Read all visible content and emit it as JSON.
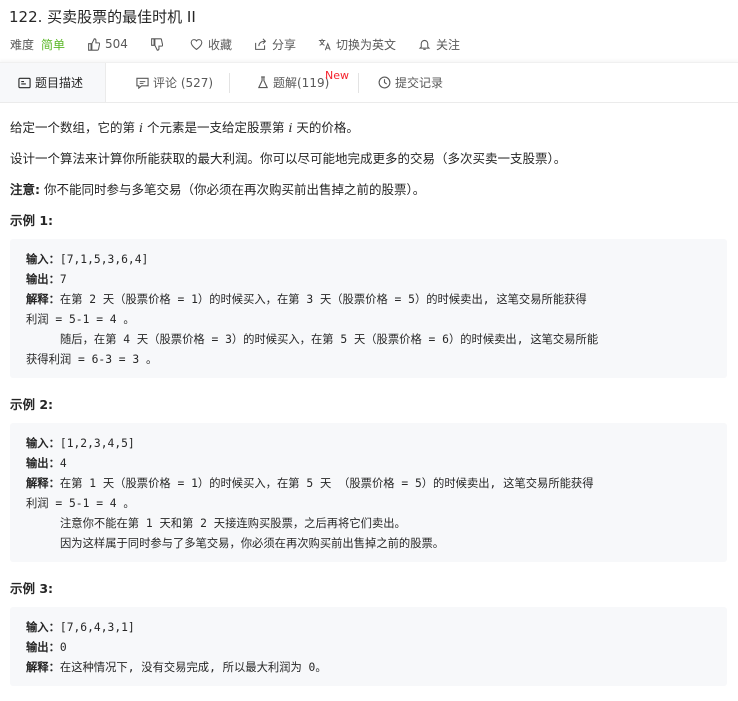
{
  "problem": {
    "title": "122. 买卖股票的最佳时机 II"
  },
  "meta": {
    "difficulty_label": "难度",
    "difficulty": "简单",
    "likes": "504",
    "favorite": "收藏",
    "share": "分享",
    "switch_lang": "切换为英文",
    "follow": "关注",
    "colors": {
      "easy": "#5ab726",
      "new_badge": "#f5222d"
    }
  },
  "tabs": [
    {
      "label": "题目描述",
      "icon": "description-icon",
      "active": true
    },
    {
      "label": "评论 (527)",
      "icon": "comment-icon"
    },
    {
      "label": "题解(119)",
      "icon": "flask-icon",
      "badge": "New"
    },
    {
      "label": "提交记录",
      "icon": "clock-icon"
    }
  ],
  "desc": {
    "p1_a": "给定一个数组，它的第 ",
    "p1_i1": "i",
    "p1_b": " 个元素是一支给定股票第 ",
    "p1_i2": "i",
    "p1_c": " 天的价格。",
    "p2": "设计一个算法来计算你所能获取的最大利润。你可以尽可能地完成更多的交易（多次买卖一支股票）。",
    "note_label": "注意:",
    "note_text": " 你不能同时参与多笔交易（你必须在再次购买前出售掉之前的股票）。"
  },
  "examples": [
    {
      "heading": "示例 1:",
      "input_label": "输入：",
      "input": "[7,1,5,3,6,4]",
      "output_label": "输出：",
      "output": "7",
      "explain_label": "解释：",
      "explain": [
        "在第 2 天（股票价格 = 1）的时候买入，在第 3 天（股票价格 = 5）的时候卖出, 这笔交易所能获得",
        "利润 = 5-1 = 4 。",
        "     随后，在第 4 天（股票价格 = 3）的时候买入，在第 5 天（股票价格 = 6）的时候卖出, 这笔交易所能",
        "获得利润 = 6-3 = 3 。"
      ]
    },
    {
      "heading": "示例 2:",
      "input_label": "输入：",
      "input": "[1,2,3,4,5]",
      "output_label": "输出：",
      "output": "4",
      "explain_label": "解释：",
      "explain": [
        "在第 1 天（股票价格 = 1）的时候买入，在第 5 天 （股票价格 = 5）的时候卖出, 这笔交易所能获得",
        "利润 = 5-1 = 4 。",
        "     注意你不能在第 1 天和第 2 天接连购买股票，之后再将它们卖出。",
        "     因为这样属于同时参与了多笔交易，你必须在再次购买前出售掉之前的股票。"
      ]
    },
    {
      "heading": "示例 3:",
      "input_label": "输入：",
      "input": "[7,6,4,3,1]",
      "output_label": "输出：",
      "output": "0",
      "explain_label": "解释：",
      "explain": [
        "在这种情况下, 没有交易完成, 所以最大利润为 0。"
      ]
    }
  ]
}
